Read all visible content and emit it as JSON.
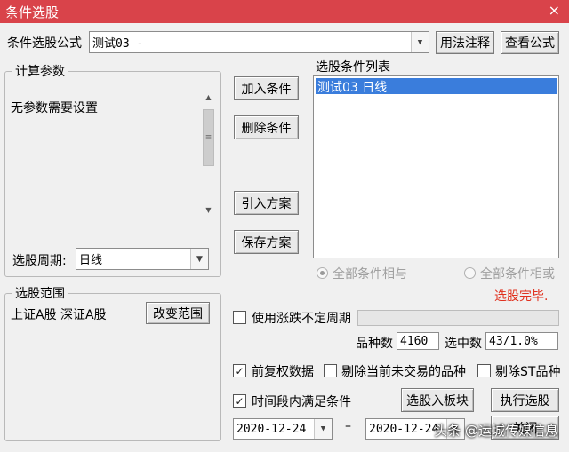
{
  "window": {
    "title": "条件选股",
    "close_glyph": "×"
  },
  "formula": {
    "label": "条件选股公式",
    "value": "测试03          -",
    "usage_button": "用法注释",
    "view_button": "查看公式"
  },
  "params": {
    "group_title": "计算参数",
    "message": "无参数需要设置",
    "period_label": "选股周期:",
    "period_value": "日线"
  },
  "actions": {
    "add": "加入条件",
    "delete": "删除条件",
    "import": "引入方案",
    "save": "保存方案"
  },
  "conditions": {
    "title": "选股条件列表",
    "items": [
      "测试03   日线"
    ],
    "radio_and": "全部条件相与",
    "radio_or": "全部条件相或",
    "status": "选股完毕.",
    "status_color": "#e0301e"
  },
  "scope": {
    "group_title": "选股范围",
    "value": "上证A股 深证A股",
    "change_button": "改变范围"
  },
  "options": {
    "unfixed_period": "使用涨跌不定周期",
    "count_label": "品种数",
    "count_value": "4160",
    "selected_label": "选中数",
    "selected_value": "43/1.0%",
    "fq_label": "前复权数据",
    "fq_checked": "✓",
    "exclude_no_trade": "剔除当前未交易的品种",
    "exclude_st": "剔除ST品种",
    "time_range_label": "时间段内满足条件",
    "time_range_checked": "✓"
  },
  "bottom": {
    "to_block_button": "选股入板块",
    "execute_button": "执行选股",
    "close_button": "关闭",
    "date_from": "2020-12-24",
    "date_to": "2020-12-24",
    "dash": "–"
  },
  "watermark": "头条 @运城传媒信息",
  "icons": [
    "close-icon",
    "dropdown-arrow-icon",
    "scroll-up-icon",
    "scroll-down-icon",
    "check-icon"
  ]
}
